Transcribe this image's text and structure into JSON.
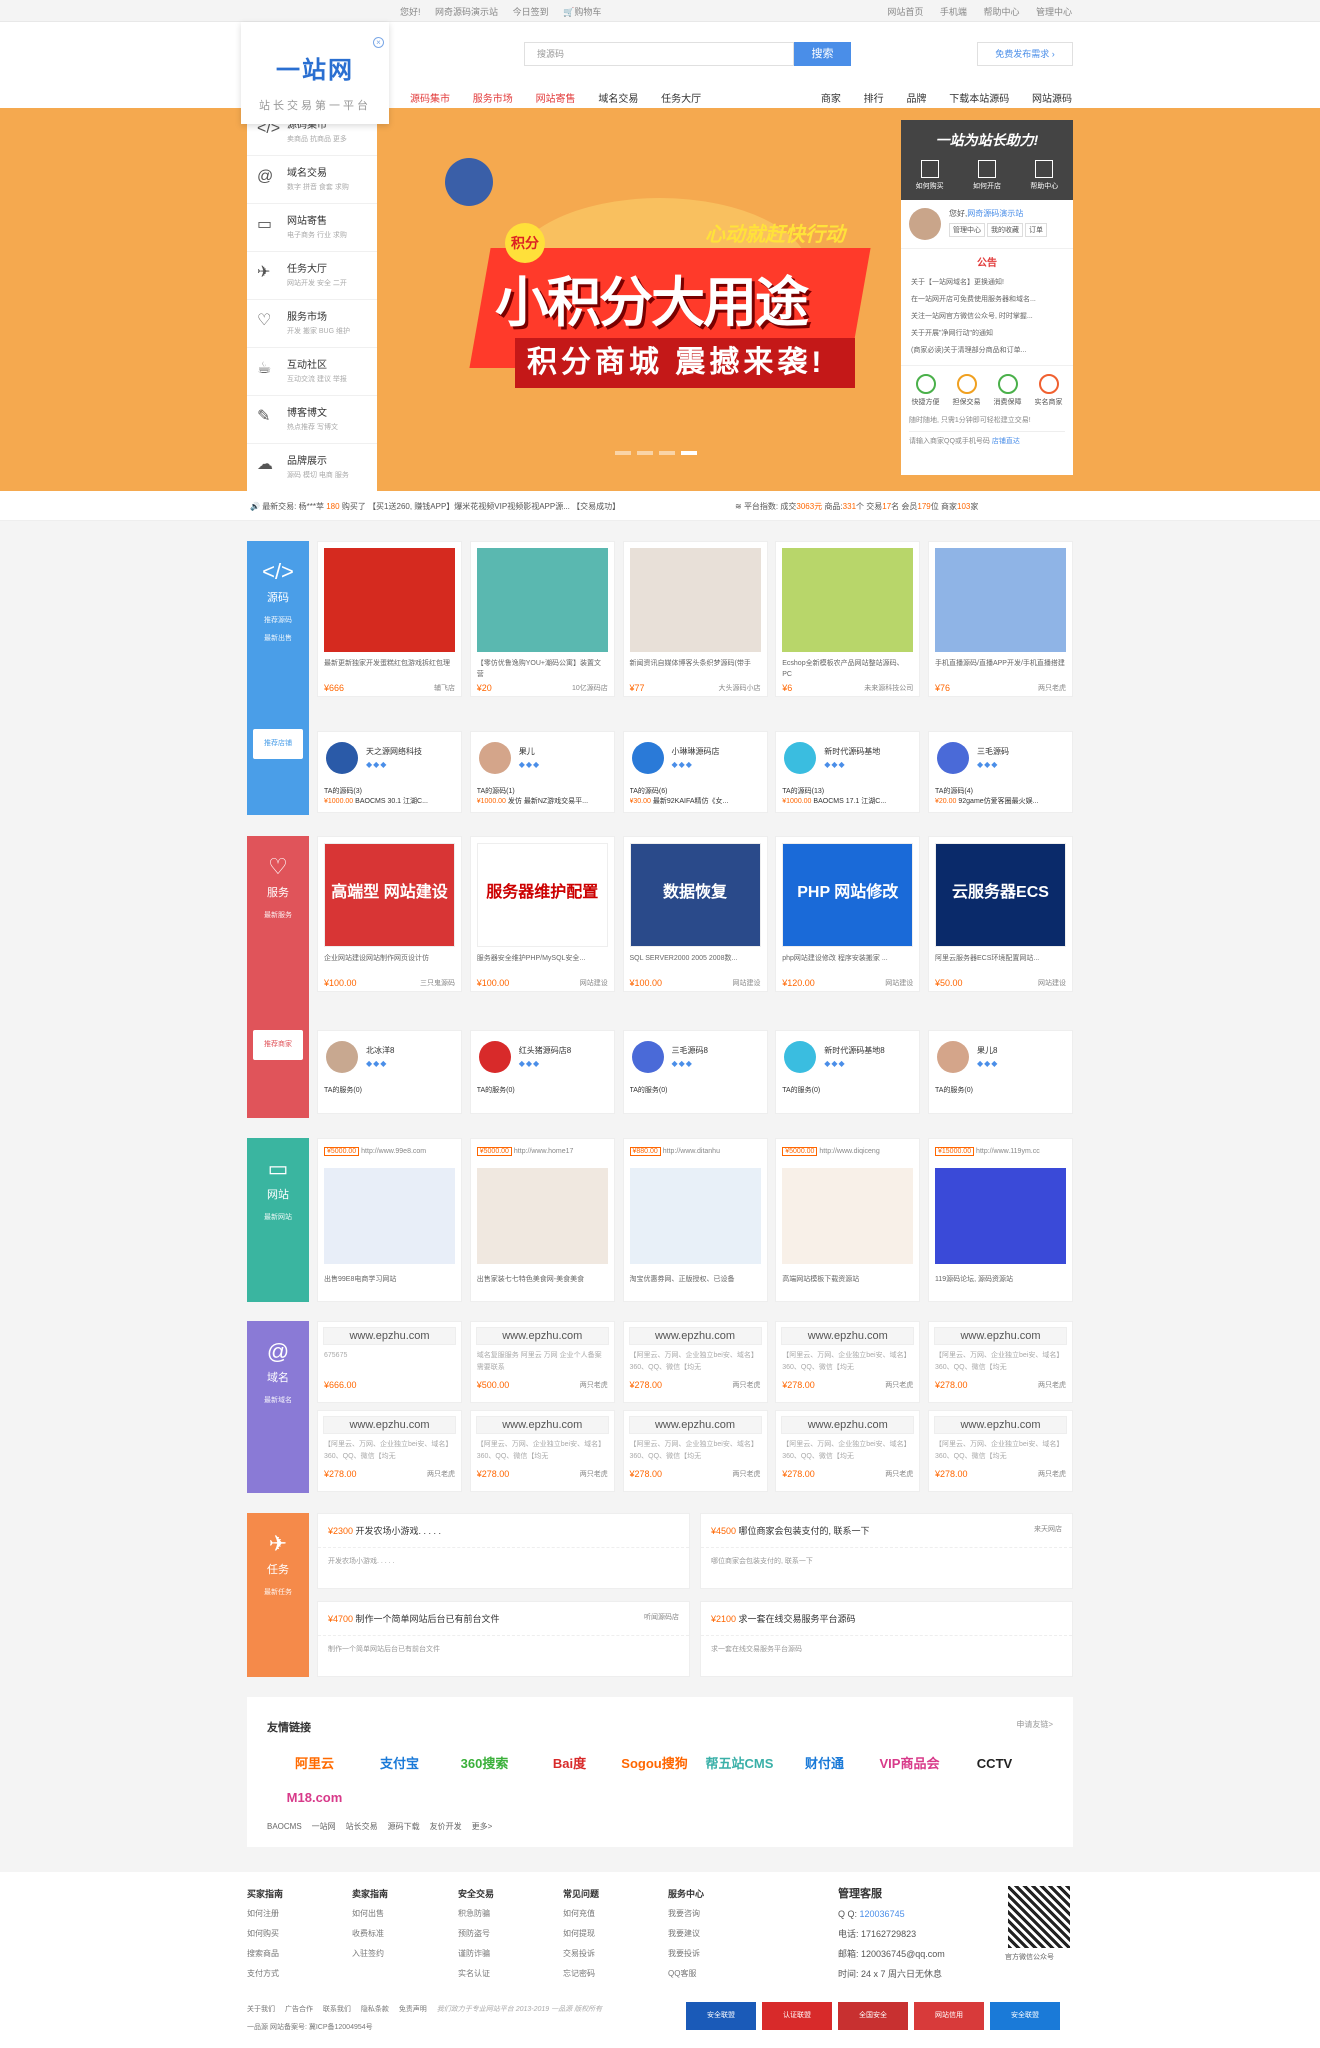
{
  "topbar": {
    "left": [
      "您好!",
      "网奇源码演示站",
      "今日签到",
      "购物车"
    ],
    "right": [
      "网站首页",
      "手机端",
      "帮助中心",
      "管理中心"
    ]
  },
  "logo": {
    "brand": "一站网",
    "slogan": "站长交易第一平台"
  },
  "search": {
    "placeholder": "搜源码",
    "button": "搜索",
    "publish": "免费发布需求 ›"
  },
  "nav": {
    "main": [
      "源码集市",
      "服务市场",
      "网站寄售",
      "域名交易",
      "任务大厅"
    ],
    "right": [
      "商家",
      "排行",
      "品牌",
      "下载本站源码",
      "网站源码"
    ]
  },
  "leftmenu": [
    {
      "icon": "</>",
      "title": "源码集市",
      "sub": "卖商品  抗商品  更多"
    },
    {
      "icon": "@",
      "title": "域名交易",
      "sub": "数字  拼音  食套  求购"
    },
    {
      "icon": "▭",
      "title": "网站寄售",
      "sub": "电子商务  行业  求购"
    },
    {
      "icon": "✈",
      "title": "任务大厅",
      "sub": "网站开发  安全  二开"
    },
    {
      "icon": "♡",
      "title": "服务市场",
      "sub": "开发  搬家  BUG  维护"
    },
    {
      "icon": "☕",
      "title": "互动社区",
      "sub": "互动交流  建议  举报"
    },
    {
      "icon": "✎",
      "title": "博客博文",
      "sub": "热点推荐  写博文"
    },
    {
      "icon": "☁",
      "title": "品牌展示",
      "sub": "源码  模切  电商  服务"
    }
  ],
  "promo": {
    "jifen": "积分",
    "sub1": "心动就赶快行动",
    "title": "小积分大用途",
    "sub2": "积分商城 震撼来袭!"
  },
  "rbox": {
    "head": "一站为站长助力!",
    "icons": [
      "如何购买",
      "如何开店",
      "帮助中心"
    ],
    "hello": "您好,",
    "user": "网奇源码演示站",
    "btns": [
      "管理中心",
      "我的收藏",
      "订单"
    ],
    "notice_h": "公告",
    "notices": [
      "关于【一站网域名】更换通知!",
      "在一站网开店可免费使用服务器和域名...",
      "关注一站网官方微信公众号, 时时掌握...",
      "关于开展\"净网行动\"的通知",
      "(商家必读)关于清理部分商品和订单..."
    ],
    "svc": [
      "快捷方便",
      "担保交易",
      "消费保障",
      "实名商家"
    ],
    "foot1": "随时随地, 只需1分钟即可轻松建立交易!",
    "foot2": "请输入商家QQ或手机号码",
    "foot2b": "店铺直达"
  },
  "ticker": {
    "label": "最新交易:",
    "buyer": "杨***苹",
    "amount": "180",
    "action": "购买了",
    "item": "【买1送260, 赚钱APP】爆米花视频VIP视频影视APP源...",
    "status": "【交易成功】",
    "stats_label": "平台指数:",
    "deal_l": "成交",
    "deal": "3063元",
    "goods_l": "商品:",
    "goods": "331",
    "goods_u": "个",
    "trade_l": "交易",
    "trade": "17",
    "trade_u": "名",
    "shop_l": "会员",
    "shop": "179",
    "shop_u": "位",
    "merchant_l": "商家",
    "merchant": "103",
    "merchant_u": "家"
  },
  "source": {
    "label": "源码",
    "tag1": "推荐源码",
    "tag2": "最新出售",
    "shop": "推荐店铺",
    "items": [
      {
        "title": "最新更新独家开发蛋糕红包游戏拆红包理",
        "price": "¥666",
        "shop": "辅飞店",
        "bg": "#d52a1f"
      },
      {
        "title": "【零仿优鲁逸购YOU+潮码公寓】装置文营",
        "price": "¥20",
        "shop": "10亿源码店",
        "bg": "#5ab8b0"
      },
      {
        "title": "新闻资讯自媒体博客头条织梦源码(带手",
        "price": "¥77",
        "shop": "大头源码小店",
        "bg": "#e8e0d8"
      },
      {
        "title": "Ecshop全新模板农产品网站整站源码、PC",
        "price": "¥6",
        "shop": "未来源科技公司",
        "bg": "#b8d66a"
      },
      {
        "title": "手机直播源码/直播APP开发/手机直播搭建",
        "price": "¥76",
        "shop": "两只老虎",
        "bg": "#8fb4e6"
      }
    ],
    "shops": [
      {
        "name": "天之源网络科技",
        "ta": "TA的源码(3)",
        "p": "¥1000.00",
        "d": "BAOCMS 30.1 江湖C...",
        "av": "#2a5aa8"
      },
      {
        "name": "果儿",
        "ta": "TA的源码(1)",
        "p": "¥1000.00",
        "d": "发仿 最新NZ游戏交易平...",
        "av": "#d4a58a"
      },
      {
        "name": "小琳琳源码店",
        "ta": "TA的源码(6)",
        "p": "¥30.00",
        "d": "最新92KAIFA精仿《女...",
        "av": "#2a7ad8"
      },
      {
        "name": "新时代源码基地",
        "ta": "TA的源码(13)",
        "p": "¥1000.00",
        "d": "BAOCMS 17.1 江湖C...",
        "av": "#3abde0"
      },
      {
        "name": "三毛源码",
        "ta": "TA的源码(4)",
        "p": "¥20.00",
        "d": "92game仿爱客圈最火娱...",
        "av": "#4a6ad8"
      }
    ]
  },
  "service": {
    "label": "服务",
    "tag1": "最新服务",
    "shop": "推荐商家",
    "items": [
      {
        "title": "企业网站建设网站制作网页设计仿",
        "price": "¥100.00",
        "shop": "三只鬼源码",
        "bg": "#d83535",
        "big": "高端型 网站建设"
      },
      {
        "title": "服务器安全维护PHP/MySQL安全...",
        "price": "¥100.00",
        "shop": "网站建设",
        "bg": "#ffffff",
        "big": "服务器维护配置"
      },
      {
        "title": "SQL SERVER2000 2005 2008数...",
        "price": "¥100.00",
        "shop": "网站建设",
        "bg": "#2a4a8a",
        "big": "数据恢复"
      },
      {
        "title": "php网站建设修改 程序安装搬家 ...",
        "price": "¥120.00",
        "shop": "网站建设",
        "bg": "#1a6ad8",
        "big": "PHP 网站修改"
      },
      {
        "title": "阿里云服务器ECS环境配置网站...",
        "price": "¥50.00",
        "shop": "网站建设",
        "bg": "#0a2a6a",
        "big": "云服务器ECS"
      }
    ],
    "shops": [
      {
        "name": "北冰洋8",
        "ta": "TA的服务(0)",
        "av": "#c8a890"
      },
      {
        "name": "红头猪源码店8",
        "ta": "TA的服务(0)",
        "av": "#d82a2a"
      },
      {
        "name": "三毛源码8",
        "ta": "TA的服务(0)",
        "av": "#4a6ad8"
      },
      {
        "name": "新时代源码基地8",
        "ta": "TA的服务(0)",
        "av": "#3abde0"
      },
      {
        "name": "果儿8",
        "ta": "TA的服务(0)",
        "av": "#d4a58a"
      }
    ]
  },
  "web": {
    "label": "网站",
    "tag1": "最新网站",
    "items": [
      {
        "price": "¥5000.00",
        "url": "http://www.99e8.com",
        "title": "出售99E8电商学习网站",
        "bg": "#e8eef8"
      },
      {
        "price": "¥5000.00",
        "url": "http://www.home17",
        "title": "出售家装七七特色美食网-美食美食",
        "bg": "#f0e8e0"
      },
      {
        "price": "¥880.00",
        "url": "http://www.ditanhu",
        "title": "淘宝优惠券网、正版授权、已设备",
        "bg": "#e8f0f8"
      },
      {
        "price": "¥5000.00",
        "url": "http://www.diqiceng",
        "title": "高端网站模板下载资源站",
        "bg": "#f8f0e8"
      },
      {
        "price": "¥15000.00",
        "url": "http://www.119ym.cc",
        "title": "119源码论坛, 源码资源站",
        "bg": "#3a4ad8"
      }
    ]
  },
  "domain": {
    "label": "域名",
    "tag1": "最新域名",
    "rows": [
      [
        {
          "dn": "www.epzhu.com",
          "ds": "675675",
          "price": "¥666.00",
          "shop": ""
        },
        {
          "dn": "www.epzhu.com",
          "ds": "域名复服服务 阿里云 万网 企业个人备案 需要联系",
          "price": "¥500.00",
          "shop": "两只老虎"
        },
        {
          "dn": "www.epzhu.com",
          "ds": "【阿里云、万网、企业独立bei安、域名】360、QQ、微信【均无",
          "price": "¥278.00",
          "shop": "两只老虎"
        },
        {
          "dn": "www.epzhu.com",
          "ds": "【阿里云、万网、企业独立bei安、域名】360、QQ、微信【均无",
          "price": "¥278.00",
          "shop": "两只老虎"
        },
        {
          "dn": "www.epzhu.com",
          "ds": "【阿里云、万网、企业独立bei安、域名】360、QQ、微信【均无",
          "price": "¥278.00",
          "shop": "两只老虎"
        }
      ],
      [
        {
          "dn": "www.epzhu.com",
          "ds": "【阿里云、万网、企业独立bei安、域名】360、QQ、微信【均无",
          "price": "¥278.00",
          "shop": "两只老虎"
        },
        {
          "dn": "www.epzhu.com",
          "ds": "【阿里云、万网、企业独立bei安、域名】360、QQ、微信【均无",
          "price": "¥278.00",
          "shop": "两只老虎"
        },
        {
          "dn": "www.epzhu.com",
          "ds": "【阿里云、万网、企业独立bei安、域名】360、QQ、微信【均无",
          "price": "¥278.00",
          "shop": "两只老虎"
        },
        {
          "dn": "www.epzhu.com",
          "ds": "【阿里云、万网、企业独立bei安、域名】360、QQ、微信【均无",
          "price": "¥278.00",
          "shop": "两只老虎"
        },
        {
          "dn": "www.epzhu.com",
          "ds": "【阿里云、万网、企业独立bei安、域名】360、QQ、微信【均无",
          "price": "¥278.00",
          "shop": "两只老虎"
        }
      ]
    ]
  },
  "task": {
    "label": "任务",
    "tag1": "最新任务",
    "items": [
      {
        "price": "¥2300",
        "title": "开发农场小游戏. . . . .",
        "desc": "开发农场小游戏. . . . .",
        "shop": ""
      },
      {
        "price": "¥4500",
        "title": "哪位商家会包装支付的, 联系一下",
        "desc": "哪位商家会包装支付的, 联系一下",
        "shop": "来天网店"
      },
      {
        "price": "¥4700",
        "title": "制作一个简单网站后台已有前台文件",
        "desc": "制作一个简单网站后台已有前台文件",
        "shop": "听闻源码店"
      },
      {
        "price": "¥2100",
        "title": "求一套在线交易服务平台源码",
        "desc": "求一套在线交易服务平台源码",
        "shop": ""
      }
    ]
  },
  "friend": {
    "title": "友情链接",
    "more": "申请友链>",
    "logos": [
      {
        "t": "阿里云",
        "c": "#ff6a00"
      },
      {
        "t": "支付宝",
        "c": "#1a7ad8"
      },
      {
        "t": "360搜索",
        "c": "#3ab03a"
      },
      {
        "t": "Bai度",
        "c": "#d82a2a"
      },
      {
        "t": "Sogou搜狗",
        "c": "#f60"
      },
      {
        "t": "帮五站CMS",
        "c": "#3ab0a8"
      },
      {
        "t": "财付通",
        "c": "#1a7ad8"
      },
      {
        "t": "VIP商品会",
        "c": "#d83a8a"
      },
      {
        "t": "CCTV",
        "c": "#222"
      },
      {
        "t": "M18.com",
        "c": "#d83a8a"
      }
    ],
    "text": [
      "BAOCMS",
      "一站网",
      "站长交易",
      "源码下载",
      "友价开发",
      "更多>"
    ]
  },
  "footer": {
    "cols": [
      {
        "h": "买家指南",
        "items": [
          "如何注册",
          "如何购买",
          "搜索商品",
          "支付方式"
        ]
      },
      {
        "h": "卖家指南",
        "items": [
          "如何出售",
          "收费标准",
          "入驻签约"
        ]
      },
      {
        "h": "安全交易",
        "items": [
          "积急防骗",
          "预防盗号",
          "谨防诈骗",
          "实名认证"
        ]
      },
      {
        "h": "常见问题",
        "items": [
          "如何充值",
          "如何提现",
          "交易投诉",
          "忘记密码"
        ]
      },
      {
        "h": "服务中心",
        "items": [
          "我要咨询",
          "我要建议",
          "我要投诉",
          "QQ客服"
        ]
      }
    ],
    "kefu_h": "管理客服",
    "qq_l": "Q Q:",
    "qq": "120036745",
    "tel_l": "电话:",
    "tel": "17162729823",
    "mail_l": "邮箱:",
    "mail": "120036745@qq.com",
    "time_l": "时间:",
    "time": "24 x 7 周六日无休息",
    "qr_cap": "官方微信公众号",
    "bottom": [
      "关于我们",
      "广告合作",
      "联系我们",
      "隐私条款",
      "免责声明"
    ],
    "copy": "我们致力于专业网站平台 2013-2019 一品源 版权所有",
    "icp": "一品源  网站备案号: 冀ICP备12004954号",
    "badges": [
      {
        "t": "安全联盟",
        "c": "#1a5ab8"
      },
      {
        "t": "认证联盟",
        "c": "#d82a2a"
      },
      {
        "t": "全国安全",
        "c": "#c83030"
      },
      {
        "t": "网站信用",
        "c": "#d83a3a"
      },
      {
        "t": "安全联盟",
        "c": "#1a7ad8"
      }
    ]
  }
}
